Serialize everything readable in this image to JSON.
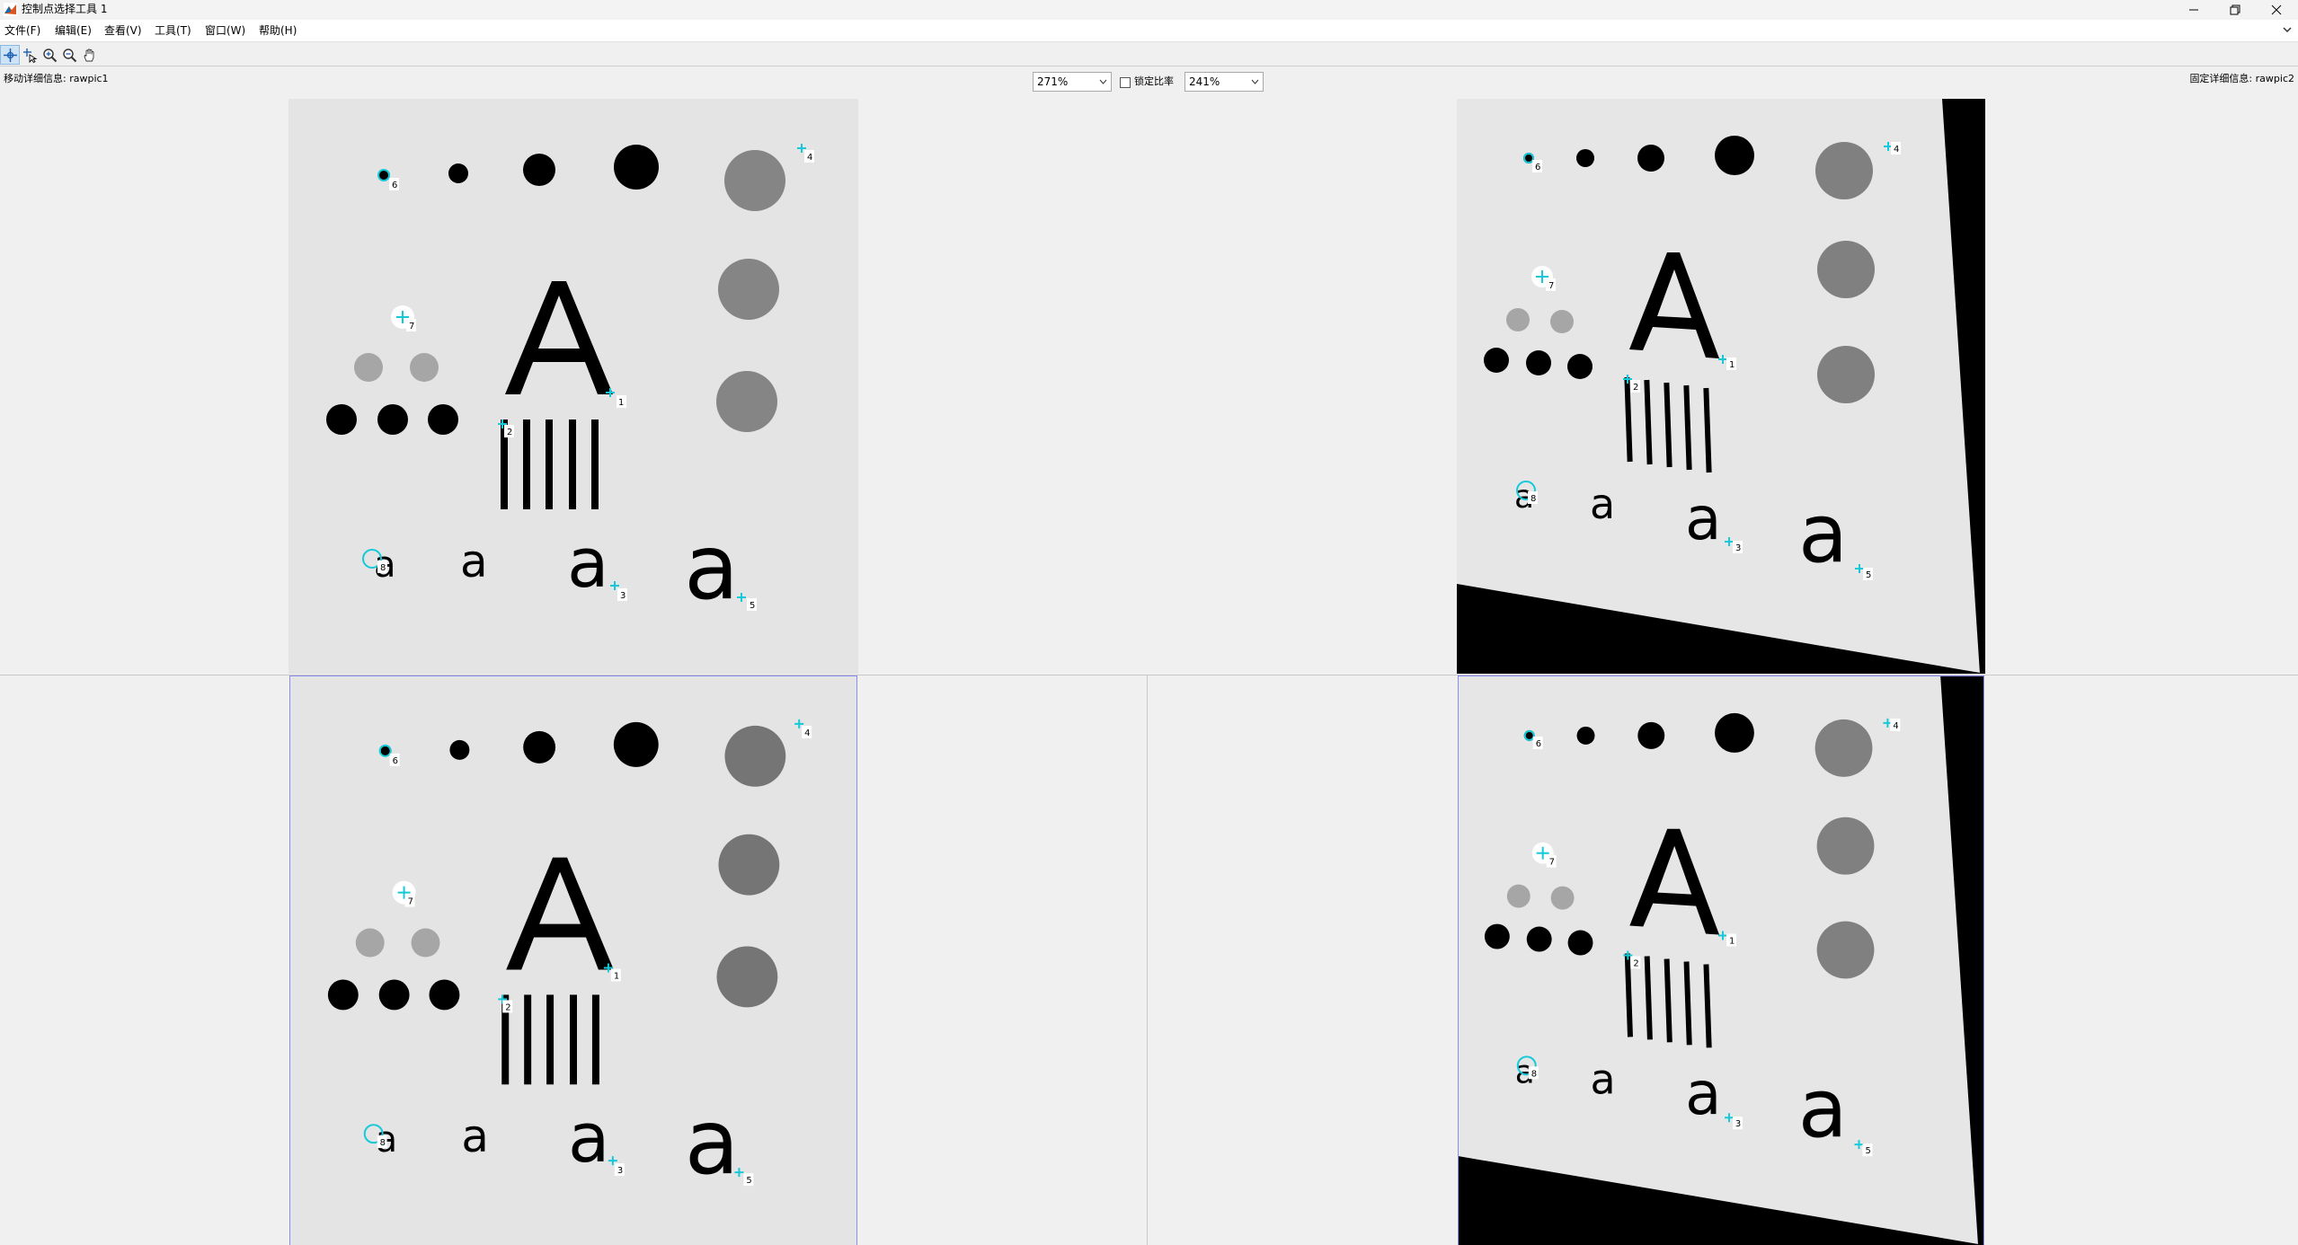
{
  "window": {
    "title": "控制点选择工具 1",
    "icon": "matlab-icon",
    "controls": [
      "minimize-icon",
      "restore-icon",
      "close-icon"
    ]
  },
  "menu": {
    "items": [
      "文件(F)",
      "编辑(E)",
      "查看(V)",
      "工具(T)",
      "窗口(W)",
      "帮助(H)"
    ]
  },
  "toolbar": {
    "tools": [
      "add-point-icon",
      "select-point-icon",
      "zoom-in-icon",
      "zoom-out-icon",
      "pan-hand-icon"
    ],
    "active_tool": "add-point-icon"
  },
  "controls": {
    "moving_label": "移动详细信息: rawpic1",
    "fixed_label": "固定详细信息: rawpic2",
    "moving_zoom": "271%",
    "lock_label": "锁定比率",
    "lock_checked": false,
    "fixed_zoom": "241%"
  },
  "colors": {
    "marker": "#16c9d8",
    "panel_border": "#8c8cf0",
    "image_background": "#e4e4e4"
  },
  "points": {
    "moving_labels": [
      "1",
      "2",
      "3",
      "4",
      "5",
      "6",
      "7",
      "8"
    ],
    "fixed_labels": [
      "1",
      "2",
      "3",
      "4",
      "5",
      "6",
      "7",
      "8"
    ]
  }
}
